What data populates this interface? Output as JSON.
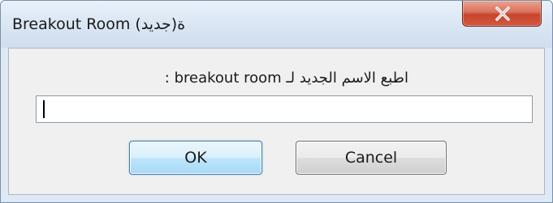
{
  "dialog": {
    "title": "Breakout Room (جديد)ة",
    "close_icon": "close-icon",
    "prompt": "اطبع الاسم الجديد لـ breakout room :",
    "input": {
      "value": "",
      "placeholder": ""
    },
    "ok_label": "OK",
    "cancel_label": "Cancel"
  },
  "colors": {
    "titlebar": "#dce7f4",
    "close_button": "#c8442c",
    "content_background": "#f0f0f0",
    "ok_border": "#3c7fb1"
  }
}
